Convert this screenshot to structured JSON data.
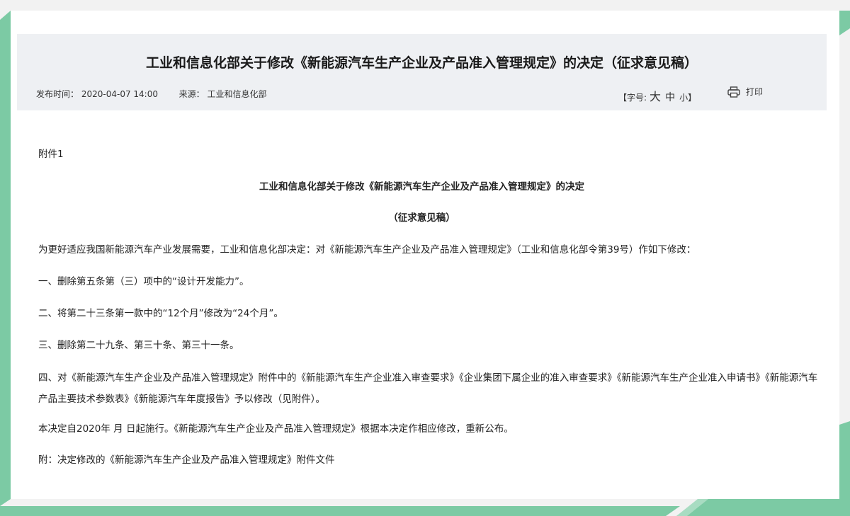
{
  "article": {
    "title": "工业和信息化部关于修改《新能源汽车生产企业及产品准入管理规定》的决定（征求意见稿）",
    "publish_label": "发布时间：",
    "publish_time": "2020-04-07 14:00",
    "source_label": "来源：",
    "source": "工业和信息化部",
    "font_size_open": "【字号:",
    "font_large": "大",
    "font_medium": "中",
    "font_small": "小】",
    "print_label": "打印"
  },
  "content": {
    "attachment": "附件1",
    "heading": "工业和信息化部关于修改《新能源汽车生产企业及产品准入管理规定》的决定",
    "subheading": "（征求意见稿）",
    "intro": "为更好适应我国新能源汽车产业发展需要，工业和信息化部决定：对《新能源汽车生产企业及产品准入管理规定》（工业和信息化部令第39号）作如下修改：",
    "item1": "一、删除第五条第（三）项中的“设计开发能力”。",
    "item2": "二、将第二十三条第一款中的“12个月”修改为“24个月”。",
    "item3": "三、删除第二十九条、第三十条、第三十一条。",
    "item4": "四、对《新能源汽车生产企业及产品准入管理规定》附件中的《新能源汽车生产企业准入审查要求》《企业集团下属企业的准入审查要求》《新能源汽车生产企业准入申请书》《新能源汽车产品主要技术参数表》《新能源汽车年度报告》予以修改（见附件）。",
    "effective": "本决定自2020年 月 日起施行。《新能源汽车生产企业及产品准入管理规定》根据本决定作相应修改，重新公布。",
    "appendix": "附：决定修改的《新能源汽车生产企业及产品准入管理规定》附件文件"
  },
  "colors": {
    "accent_green": "#7ccaa4",
    "header_bg": "#eef0f3"
  }
}
